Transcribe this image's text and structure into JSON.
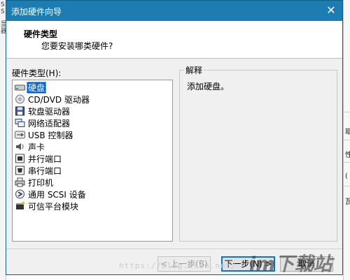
{
  "background": {
    "left_glyphs": [
      "S",
      "S",
      "显",
      "器"
    ],
    "right_cells": [
      "耶",
      "性",
      "(",
      "瓦"
    ]
  },
  "dialog": {
    "title": "添加硬件向导",
    "close_glyph": "✕",
    "header_title": "硬件类型",
    "header_subtitle": "您要安装哪类硬件?",
    "list_label": "硬件类型(H):",
    "items": [
      {
        "label": "硬盘",
        "icon": "hard-disk-icon",
        "selected": true
      },
      {
        "label": "CD/DVD 驱动器",
        "icon": "cd-dvd-icon",
        "selected": false
      },
      {
        "label": "软盘驱动器",
        "icon": "floppy-icon",
        "selected": false
      },
      {
        "label": "网络适配器",
        "icon": "network-adapter-icon",
        "selected": false
      },
      {
        "label": "USB 控制器",
        "icon": "usb-icon",
        "selected": false
      },
      {
        "label": "声卡",
        "icon": "sound-card-icon",
        "selected": false
      },
      {
        "label": "并行端口",
        "icon": "parallel-port-icon",
        "selected": false
      },
      {
        "label": "串行端口",
        "icon": "serial-port-icon",
        "selected": false
      },
      {
        "label": "打印机",
        "icon": "printer-icon",
        "selected": false
      },
      {
        "label": "通用 SCSI 设备",
        "icon": "scsi-icon",
        "selected": false
      },
      {
        "label": "可信平台模块",
        "icon": "tpm-icon",
        "selected": false
      }
    ],
    "explain_title": "解释",
    "explain_text": "添加硬盘。",
    "back_label": "< 上一步(B)",
    "next_label": "下一步(N) >",
    "cancel_label": "取消"
  },
  "watermark": {
    "url": "https://blog.csdn.net/",
    "logo": "im下载站"
  },
  "colors": {
    "titlebar": "#1d7db2",
    "selection": "#0a63c9",
    "dialog_bg": "#f0f0f0"
  }
}
